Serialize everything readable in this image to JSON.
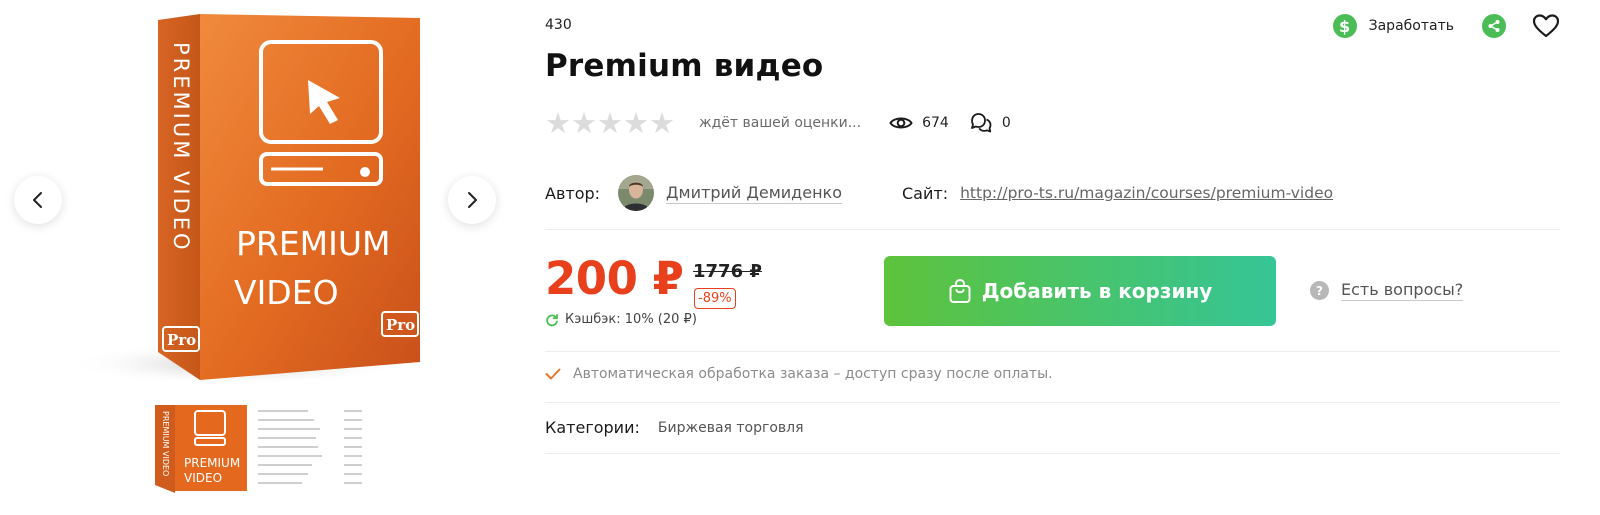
{
  "product": {
    "sku": "430",
    "title": "Premium видео",
    "rating_text": "ждёт вашей оценки...",
    "views": "674",
    "comments": "0",
    "rating_stars": 0,
    "rating_max": 5
  },
  "actions": {
    "earn_label": "Заработать"
  },
  "author": {
    "label": "Автор:",
    "name": "Дмитрий Демиденко",
    "site_label": "Сайт:",
    "site_url": "http://pro-ts.ru/magazin/courses/premium-video"
  },
  "pricing": {
    "price": "200 ₽",
    "old_price": "1776 ₽",
    "discount": "-89%",
    "cashback": "Кэшбэк: 10% (20 ₽)"
  },
  "cart": {
    "button_label": "Добавить в корзину"
  },
  "questions": {
    "label": "Есть вопросы?"
  },
  "notice": {
    "text": "Автоматическая обработка заказа – доступ сразу после оплаты."
  },
  "category": {
    "label": "Категории:",
    "value": "Биржевая торговля"
  },
  "box_image": {
    "side_text": "PREMIUM VIDEO",
    "front_line1": "PREMIUM",
    "front_line2": "VIDEO",
    "badge": "Pro"
  },
  "thumb_image": {
    "line1": "PREMIUM",
    "line2": "VIDEO"
  },
  "colors": {
    "accent_red": "#e8401c",
    "green": "#4cbd56",
    "cart_gradient_start": "#5ec33c",
    "cart_gradient_end": "#36c596",
    "box_orange": "#e3661f"
  },
  "icons": {
    "prev": "chevron-left-icon",
    "next": "chevron-right-icon",
    "earn": "dollar-icon",
    "share": "share-icon",
    "favorite": "heart-icon",
    "views": "eye-icon",
    "comments": "comment-icon",
    "cashback": "refresh-icon",
    "cart": "shopping-bag-icon",
    "questions": "question-icon",
    "notice": "check-icon"
  }
}
